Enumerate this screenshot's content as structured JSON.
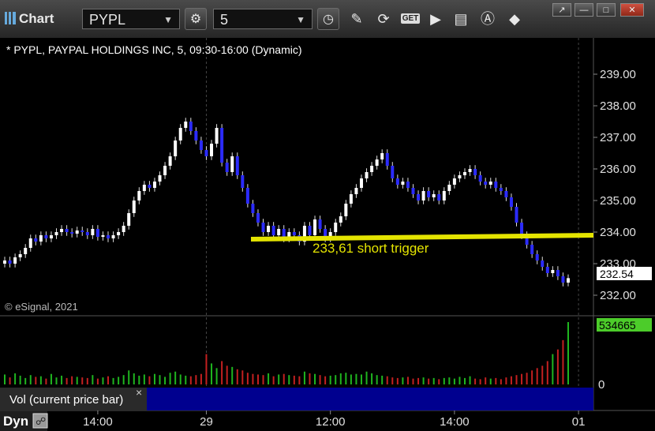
{
  "app": {
    "title": "Chart"
  },
  "toolbar": {
    "symbol": "PYPL",
    "interval": "5",
    "get_label": "GET"
  },
  "chart": {
    "header": "* PYPL, PAYPAL HOLDINGS INC, 5, 09:30-16:00 (Dynamic)",
    "watermark": "© eSignal, 2021",
    "annotation": "233,61 short trigger",
    "trigger_level": 233.61,
    "price_tag": "232.54",
    "volume_tag": "534665",
    "volume_zero_label": "0",
    "volume_label": "Vol (current price bar)",
    "dyn_label": "Dyn",
    "close_x": "×"
  },
  "colors": {
    "up": "#ffffff",
    "down": "#2b2bff",
    "vol_up": "#1fb51f",
    "vol_down": "#c42020",
    "trigger": "#e4e400",
    "background": "#000000",
    "grid": "#444444"
  },
  "chart_data": {
    "type": "candlestick",
    "title": "* PYPL, PAYPAL HOLDINGS INC, 5, 09:30-16:00 (Dynamic)",
    "y_ticks": [
      "239.00",
      "238.00",
      "237.00",
      "236.00",
      "235.00",
      "234.00",
      "233.00",
      "232.00"
    ],
    "ylim": [
      231.45,
      239.4
    ],
    "x_ticks": [
      {
        "label": "14:00",
        "bar": 18
      },
      {
        "label": "29",
        "bar": 39
      },
      {
        "label": "12:00",
        "bar": 63
      },
      {
        "label": "14:00",
        "bar": 87
      },
      {
        "label": "01",
        "bar": 111
      }
    ],
    "session_breaks": [
      39,
      111
    ],
    "volume_ticks": [
      "500000",
      "0"
    ],
    "volume_ylim": [
      0,
      534665
    ],
    "last_price": 232.54,
    "last_volume": 534665,
    "closes": [
      233.1,
      233.0,
      233.2,
      233.3,
      233.5,
      233.8,
      233.7,
      233.9,
      233.8,
      233.9,
      234.0,
      234.1,
      234.0,
      233.95,
      234.05,
      234.0,
      233.9,
      234.1,
      233.85,
      233.9,
      233.8,
      233.9,
      234.0,
      234.2,
      234.6,
      235.0,
      235.3,
      235.5,
      235.4,
      235.6,
      235.8,
      236.1,
      236.4,
      236.9,
      237.3,
      237.5,
      237.2,
      236.9,
      236.6,
      236.4,
      236.8,
      237.3,
      236.2,
      235.9,
      236.4,
      235.8,
      235.4,
      234.9,
      234.6,
      234.3,
      234.0,
      234.2,
      233.9,
      234.1,
      233.8,
      234.0,
      233.9,
      233.7,
      234.2,
      233.9,
      234.4,
      234.1,
      233.8,
      234.0,
      234.3,
      234.5,
      234.9,
      235.2,
      235.4,
      235.7,
      235.9,
      236.1,
      236.3,
      236.5,
      236.1,
      235.7,
      235.5,
      235.6,
      235.4,
      235.2,
      235.0,
      235.3,
      235.1,
      235.2,
      235.0,
      235.3,
      235.5,
      235.7,
      235.8,
      235.9,
      236.0,
      235.8,
      235.6,
      235.5,
      235.6,
      235.4,
      235.3,
      235.1,
      234.8,
      234.3,
      233.9,
      233.6,
      233.3,
      233.1,
      232.9,
      232.7,
      232.8,
      232.6,
      232.4,
      232.54
    ],
    "volumes": [
      85000,
      60000,
      95000,
      75000,
      55000,
      80000,
      65000,
      70000,
      50000,
      90000,
      60000,
      75000,
      55000,
      70000,
      65000,
      60000,
      55000,
      80000,
      50000,
      60000,
      70000,
      55000,
      65000,
      80000,
      120000,
      95000,
      75000,
      85000,
      70000,
      90000,
      80000,
      65000,
      100000,
      110000,
      85000,
      75000,
      70000,
      80000,
      90000,
      260000,
      180000,
      140000,
      200000,
      160000,
      150000,
      130000,
      120000,
      100000,
      90000,
      85000,
      80000,
      95000,
      70000,
      85000,
      90000,
      80000,
      75000,
      70000,
      110000,
      95000,
      90000,
      80000,
      70000,
      75000,
      80000,
      95000,
      100000,
      85000,
      90000,
      85000,
      110000,
      95000,
      80000,
      75000,
      70000,
      60000,
      55000,
      60000,
      65000,
      50000,
      55000,
      60000,
      50000,
      55000,
      45000,
      55000,
      60000,
      50000,
      65000,
      55000,
      70000,
      50000,
      45000,
      60000,
      50000,
      55000,
      45000,
      60000,
      70000,
      80000,
      90000,
      100000,
      120000,
      140000,
      160000,
      200000,
      260000,
      300000,
      380000,
      534665
    ]
  }
}
